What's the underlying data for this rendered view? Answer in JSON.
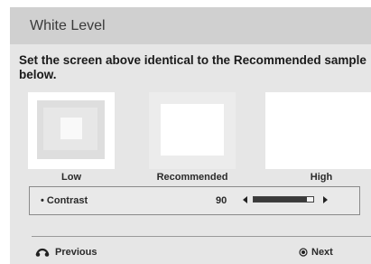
{
  "title": "White Level",
  "instruction": {
    "line1": "Set the screen above identical to the Recommended sample",
    "line2": "below."
  },
  "samples": [
    {
      "label": "Low"
    },
    {
      "label": "Recommended"
    },
    {
      "label": "High"
    }
  ],
  "contrast": {
    "label": "• Contrast",
    "value": "90",
    "level_fraction": 0.9
  },
  "footer": {
    "previous": "Previous",
    "previous_icon": "return-icon",
    "next": "Next",
    "next_icon": "ok-button-icon"
  },
  "colors": {
    "panel": "#e6e6e6",
    "titlebar": "#d0d0d0",
    "sample_white": "#ffffff"
  }
}
